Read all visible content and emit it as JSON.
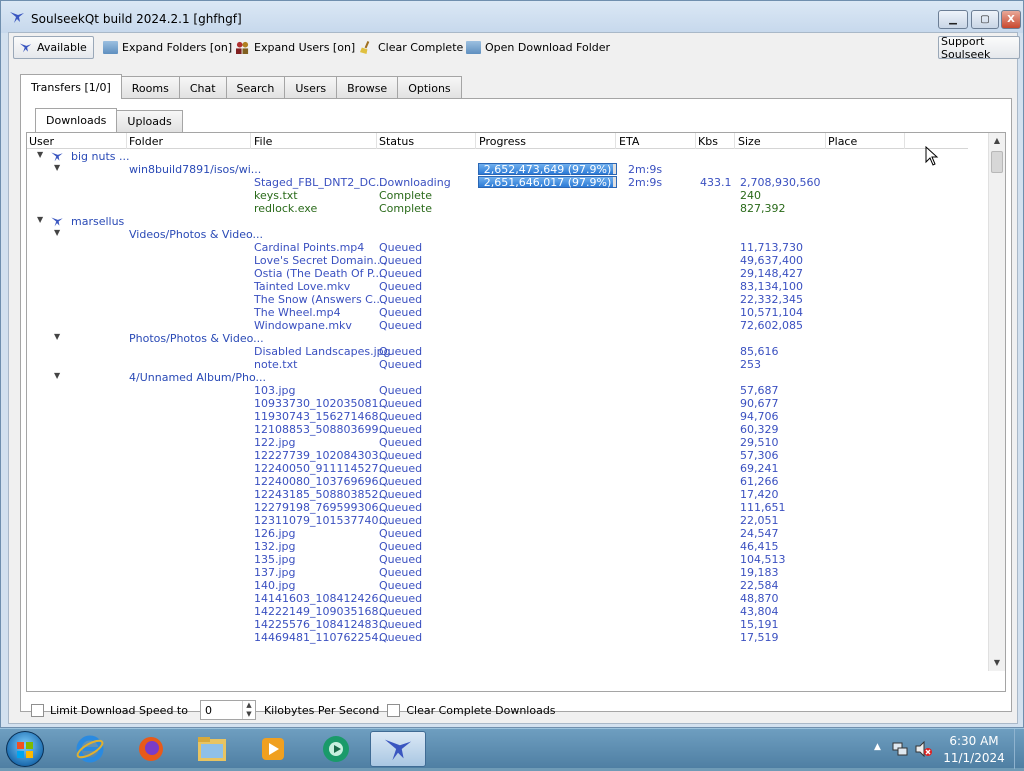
{
  "window": {
    "title": "SoulseekQt build 2024.2.1 [ghfhgf]",
    "min_label": "▁",
    "max_label": "▢",
    "close_label": "X"
  },
  "toolbar": {
    "available": "Available",
    "expand_folders": "Expand Folders [on]",
    "expand_users": "Expand Users [on]",
    "clear_complete": "Clear Complete",
    "open_download_folder": "Open Download Folder",
    "support": "Support Soulseek"
  },
  "tabs": [
    "Transfers [1/0]",
    "Rooms",
    "Chat",
    "Search",
    "Users",
    "Browse",
    "Options"
  ],
  "subtabs": [
    "Downloads",
    "Uploads"
  ],
  "columns": [
    "User",
    "Folder",
    "File",
    "Status",
    "Progress",
    "ETA",
    "Kbs",
    "Size",
    "Place"
  ],
  "rows": [
    {
      "kind": "user",
      "user": "big nuts ..."
    },
    {
      "kind": "folder",
      "folder": "win8build7891/isos/wi...",
      "progress": "2,652,473,649 (97.9%)",
      "progress_pct": 97.9,
      "eta": "2m:9s"
    },
    {
      "kind": "file",
      "file": "Staged_FBL_DNT2_DC...",
      "status": "Downloading",
      "progress": "2,651,646,017 (97.9%)",
      "progress_pct": 97.9,
      "eta": "2m:9s",
      "kbs": "433.1",
      "size": "2,708,930,560"
    },
    {
      "kind": "file",
      "done": true,
      "file": "keys.txt",
      "status": "Complete",
      "size": "240"
    },
    {
      "kind": "file",
      "done": true,
      "file": "redlock.exe",
      "status": "Complete",
      "size": "827,392"
    },
    {
      "kind": "user",
      "user": "marsellus"
    },
    {
      "kind": "folder",
      "folder": "Videos/Photos & Video..."
    },
    {
      "kind": "file",
      "file": "Cardinal Points.mp4",
      "status": "Queued",
      "size": "11,713,730"
    },
    {
      "kind": "file",
      "file": "Love's Secret Domain....",
      "status": "Queued",
      "size": "49,637,400"
    },
    {
      "kind": "file",
      "file": "Ostia (The Death Of P...",
      "status": "Queued",
      "size": "29,148,427"
    },
    {
      "kind": "file",
      "file": "Tainted Love.mkv",
      "status": "Queued",
      "size": "83,134,100"
    },
    {
      "kind": "file",
      "file": "The Snow (Answers C...",
      "status": "Queued",
      "size": "22,332,345"
    },
    {
      "kind": "file",
      "file": "The Wheel.mp4",
      "status": "Queued",
      "size": "10,571,104"
    },
    {
      "kind": "file",
      "file": "Windowpane.mkv",
      "status": "Queued",
      "size": "72,602,085"
    },
    {
      "kind": "folder",
      "folder": "Photos/Photos & Video..."
    },
    {
      "kind": "file",
      "file": "Disabled Landscapes.jpg",
      "status": "Queued",
      "size": "85,616"
    },
    {
      "kind": "file",
      "file": "note.txt",
      "status": "Queued",
      "size": "253"
    },
    {
      "kind": "folder",
      "folder": "4/Unnamed Album/Pho..."
    },
    {
      "kind": "file",
      "file": "103.jpg",
      "status": "Queued",
      "size": "57,687"
    },
    {
      "kind": "file",
      "file": "10933730_102035081...",
      "status": "Queued",
      "size": "90,677"
    },
    {
      "kind": "file",
      "file": "11930743_156271468...",
      "status": "Queued",
      "size": "94,706"
    },
    {
      "kind": "file",
      "file": "12108853_508803699...",
      "status": "Queued",
      "size": "60,329"
    },
    {
      "kind": "file",
      "file": "122.jpg",
      "status": "Queued",
      "size": "29,510"
    },
    {
      "kind": "file",
      "file": "12227739_102084303...",
      "status": "Queued",
      "size": "57,306"
    },
    {
      "kind": "file",
      "file": "12240050_911114527...",
      "status": "Queued",
      "size": "69,241"
    },
    {
      "kind": "file",
      "file": "12240080_103769696...",
      "status": "Queued",
      "size": "61,266"
    },
    {
      "kind": "file",
      "file": "12243185_508803852...",
      "status": "Queued",
      "size": "17,420"
    },
    {
      "kind": "file",
      "file": "12279198_769599306...",
      "status": "Queued",
      "size": "111,651"
    },
    {
      "kind": "file",
      "file": "12311079_101537740...",
      "status": "Queued",
      "size": "22,051"
    },
    {
      "kind": "file",
      "file": "126.jpg",
      "status": "Queued",
      "size": "24,547"
    },
    {
      "kind": "file",
      "file": "132.jpg",
      "status": "Queued",
      "size": "46,415"
    },
    {
      "kind": "file",
      "file": "135.jpg",
      "status": "Queued",
      "size": "104,513"
    },
    {
      "kind": "file",
      "file": "137.jpg",
      "status": "Queued",
      "size": "19,183"
    },
    {
      "kind": "file",
      "file": "140.jpg",
      "status": "Queued",
      "size": "22,584"
    },
    {
      "kind": "file",
      "file": "14141603_108412426...",
      "status": "Queued",
      "size": "48,870"
    },
    {
      "kind": "file",
      "file": "14222149_109035168...",
      "status": "Queued",
      "size": "43,804"
    },
    {
      "kind": "file",
      "file": "14225576_108412483...",
      "status": "Queued",
      "size": "15,191"
    },
    {
      "kind": "file",
      "file": "14469481_110762254...",
      "status": "Queued",
      "size": "17,519"
    }
  ],
  "bottom": {
    "limit_label": "Limit Download Speed to",
    "speed_value": "0",
    "units_label": "Kilobytes Per Second",
    "clear_label": "Clear Complete Downloads"
  },
  "taskbar": {
    "time": "6:30 AM",
    "date": "11/1/2024"
  }
}
